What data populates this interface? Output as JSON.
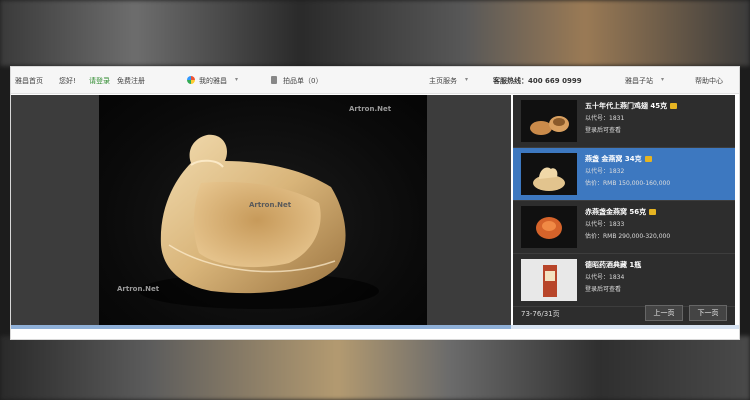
{
  "topnav": {
    "home": "雅昌首页",
    "greeting": "您好!",
    "login": "请登录",
    "register": "免费注册",
    "my_artron": "我的雅昌",
    "cart": "拍品单（0）",
    "nav": "主页服务",
    "hotline": "客服热线：400 669 0999",
    "child": "雅昌子站",
    "help": "帮助中心"
  },
  "viewer": {
    "watermark": "Artron.Net"
  },
  "sidebar": {
    "items": [
      {
        "title": "五十年代上燕门鸡翅 45克",
        "lot": "以代号：1831",
        "est": "登录后可查看"
      },
      {
        "title": "燕盏 金燕窝 34克",
        "lot": "以代号：1832",
        "est": "估价：RMB 150,000-160,000"
      },
      {
        "title": "赤燕盏金燕窝 56克",
        "lot": "以代号：1833",
        "est": "估价：RMB 290,000-320,000"
      },
      {
        "title": "德昭药酒典藏 1瓶",
        "lot": "以代号：1834",
        "est": "登录后可查看"
      }
    ],
    "counter": "73-76/31页",
    "prev": "上一页",
    "next": "下一页"
  },
  "colors": {
    "accent": "#3d78c0",
    "badge": "#e6b422",
    "login_green": "#2d8a2d"
  }
}
